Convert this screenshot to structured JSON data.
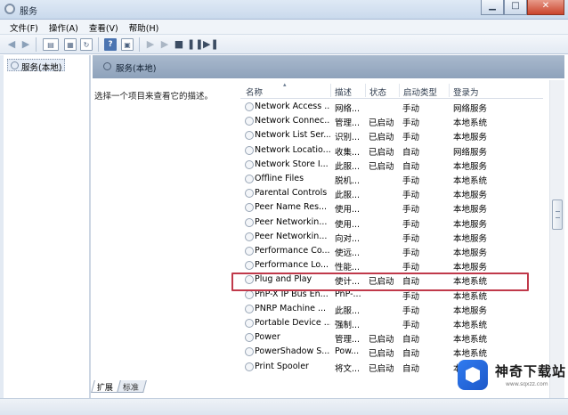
{
  "window": {
    "title": "服务"
  },
  "menu": [
    "文件(F)",
    "操作(A)",
    "查看(V)",
    "帮助(H)"
  ],
  "tree": {
    "root": "服务(本地)"
  },
  "content": {
    "header_title": "服务(本地)",
    "description_prompt": "选择一个项目来查看它的描述。"
  },
  "columns": {
    "name": "名称",
    "description": "描述",
    "status": "状态",
    "startup": "启动类型",
    "logon": "登录为"
  },
  "services": [
    {
      "name": "Network Access ...",
      "description": "网络...",
      "status": "",
      "startup": "手动",
      "logon": "网络服务"
    },
    {
      "name": "Network Connec...",
      "description": "管理...",
      "status": "已启动",
      "startup": "手动",
      "logon": "本地系统"
    },
    {
      "name": "Network List Ser...",
      "description": "识别...",
      "status": "已启动",
      "startup": "手动",
      "logon": "本地服务"
    },
    {
      "name": "Network Locatio...",
      "description": "收集...",
      "status": "已启动",
      "startup": "自动",
      "logon": "网络服务"
    },
    {
      "name": "Network Store I...",
      "description": "此服...",
      "status": "已启动",
      "startup": "自动",
      "logon": "本地服务"
    },
    {
      "name": "Offline Files",
      "description": "脱机...",
      "status": "",
      "startup": "手动",
      "logon": "本地系统"
    },
    {
      "name": "Parental Controls",
      "description": "此服...",
      "status": "",
      "startup": "手动",
      "logon": "本地服务"
    },
    {
      "name": "Peer Name Res...",
      "description": "使用...",
      "status": "",
      "startup": "手动",
      "logon": "本地服务"
    },
    {
      "name": "Peer Networkin...",
      "description": "使用...",
      "status": "",
      "startup": "手动",
      "logon": "本地服务"
    },
    {
      "name": "Peer Networkin...",
      "description": "向对...",
      "status": "",
      "startup": "手动",
      "logon": "本地服务"
    },
    {
      "name": "Performance Co...",
      "description": "使远...",
      "status": "",
      "startup": "手动",
      "logon": "本地服务"
    },
    {
      "name": "Performance Lo...",
      "description": "性能...",
      "status": "",
      "startup": "手动",
      "logon": "本地服务"
    },
    {
      "name": "Plug and Play",
      "description": "使计...",
      "status": "已启动",
      "startup": "自动",
      "logon": "本地系统"
    },
    {
      "name": "PnP-X IP Bus En...",
      "description": "PnP-...",
      "status": "",
      "startup": "手动",
      "logon": "本地系统"
    },
    {
      "name": "PNRP Machine ...",
      "description": "此服...",
      "status": "",
      "startup": "手动",
      "logon": "本地服务"
    },
    {
      "name": "Portable Device ...",
      "description": "强制...",
      "status": "",
      "startup": "手动",
      "logon": "本地系统"
    },
    {
      "name": "Power",
      "description": "管理...",
      "status": "已启动",
      "startup": "自动",
      "logon": "本地系统"
    },
    {
      "name": "PowerShadow S...",
      "description": "Pow...",
      "status": "已启动",
      "startup": "自动",
      "logon": "本地系统"
    },
    {
      "name": "Print Spooler",
      "description": "将文...",
      "status": "已启动",
      "startup": "自动",
      "logon": "本地系统"
    }
  ],
  "tabs": [
    "扩展",
    "标准"
  ],
  "watermark": {
    "name": "神奇下载站",
    "url": "www.sqxzz.com"
  },
  "colors": {
    "highlight_border": "#c0394a",
    "header_bg": "#a9b9cd"
  }
}
